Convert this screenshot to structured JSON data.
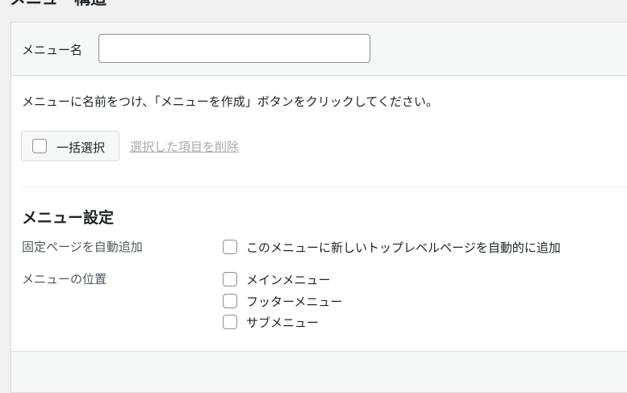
{
  "page": {
    "heading": "メニュー構造"
  },
  "menu_name": {
    "label": "メニュー名",
    "value": "",
    "placeholder": ""
  },
  "instructions": "メニューに名前をつけ、「メニューを作成」ボタンをクリックしてください。",
  "bulk_actions": {
    "select_all_label": "一括選択",
    "delete_selected_label": "選択した項目を削除"
  },
  "menu_settings": {
    "title": "メニュー設定",
    "auto_add": {
      "label": "固定ページを自動追加",
      "option": "このメニューに新しいトップレベルページを自動的に追加",
      "checked": false
    },
    "locations": {
      "label": "メニューの位置",
      "options": [
        {
          "label": "メインメニュー",
          "checked": false
        },
        {
          "label": "フッターメニュー",
          "checked": false
        },
        {
          "label": "サブメニュー",
          "checked": false
        }
      ]
    }
  },
  "colors": {
    "panel_bg": "#ffffff",
    "header_bg": "#f6f7f7",
    "border": "#dcdcde",
    "text": "#1d2327",
    "muted_text": "#50575e",
    "disabled_link": "#a7aaad"
  }
}
